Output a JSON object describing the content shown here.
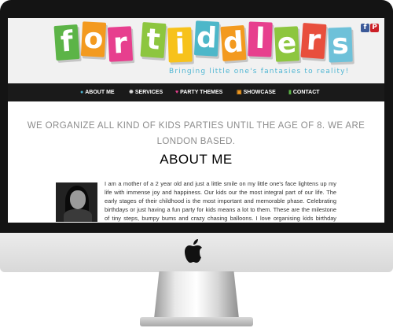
{
  "logo": {
    "letters": [
      {
        "char": "f",
        "color": "#5cb447"
      },
      {
        "char": "o",
        "color": "#f39a1f"
      },
      {
        "char": "r",
        "color": "#e73f8e"
      },
      {
        "char": "t",
        "color": "#8dc63f"
      },
      {
        "char": "i",
        "color": "#f7c21b"
      },
      {
        "char": "d",
        "color": "#4db7c9"
      },
      {
        "char": "d",
        "color": "#f39a1f"
      },
      {
        "char": "l",
        "color": "#e73f8e"
      },
      {
        "char": "e",
        "color": "#8dc63f"
      },
      {
        "char": "r",
        "color": "#e84f3d"
      },
      {
        "char": "s",
        "color": "#6ec1d9"
      }
    ],
    "tagline": "Bringing little one's fantasies to reality!"
  },
  "social": {
    "facebook": "f",
    "pinterest": "P",
    "facebook_color": "#3b5998",
    "pinterest_color": "#cb2027"
  },
  "nav": {
    "items": [
      {
        "label": "ABOUT ME",
        "icon": "person-icon",
        "icon_color": "#4fb6d3"
      },
      {
        "label": "SERVICES",
        "icon": "gear-icon",
        "icon_color": "#dddddd"
      },
      {
        "label": "PARTY THEMES",
        "icon": "heart-icon",
        "icon_color": "#e73f8e"
      },
      {
        "label": "SHOWCASE",
        "icon": "image-icon",
        "icon_color": "#f39a1f"
      },
      {
        "label": "CONTACT",
        "icon": "chat-icon",
        "icon_color": "#5cb447"
      }
    ]
  },
  "main": {
    "headline": "We organize all kind of kids parties until the age of 8. We are London based.",
    "about_title": "ABOUT ME",
    "about_text": "I am a mother of a 2 year old and just a little smile on my little one's face lightens up my life with immense joy and happiness. Our kids our the most integral part of our life. The early stages of their childhood is the most important and memorable phase. Celebrating birthdays or just having a fun party for kids means a lot to them. These are the milestone of tiny steps, bumpy bums and crazy chasing balloons. I love organising kids birthday parties or events with imagination and fantasies to make the"
  }
}
